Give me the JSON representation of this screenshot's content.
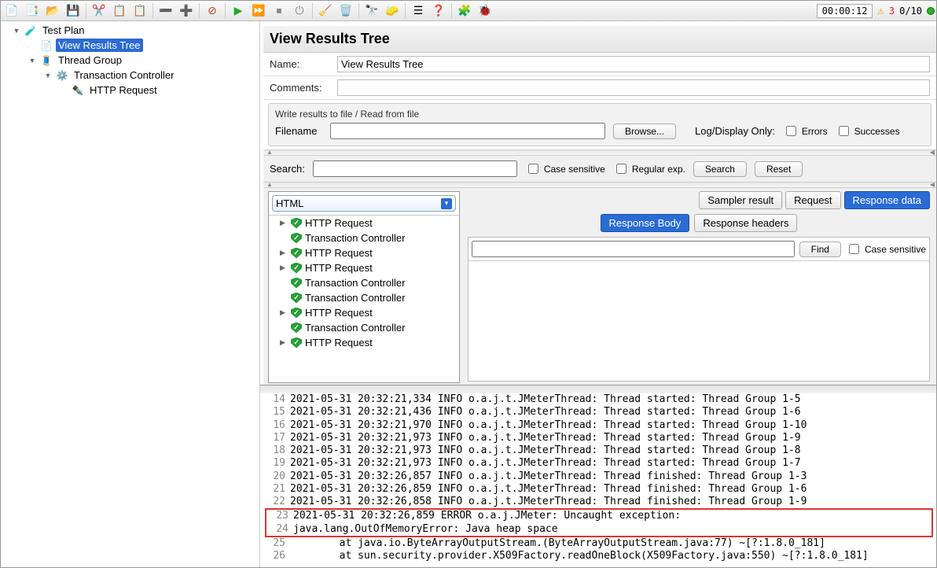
{
  "status_bar": {
    "timer": "00:00:12",
    "warn_count": "3",
    "threads": "0/10"
  },
  "toolbar_icons": [
    "new",
    "templates",
    "open",
    "save",
    "",
    "cut",
    "copy",
    "paste",
    "",
    "expand",
    "collapse",
    "",
    "toggle",
    "",
    "start",
    "start-no-pause",
    "stop",
    "shutdown",
    "",
    "clear",
    "clear-all",
    "",
    "search-tb",
    "func",
    "",
    "props",
    "help",
    "",
    "heap",
    "debug"
  ],
  "tree": [
    {
      "depth": 1,
      "twisty": "▼",
      "icon": "🧪",
      "label": "Test Plan",
      "selected": false,
      "name": "tree-test-plan"
    },
    {
      "depth": 2,
      "twisty": "",
      "icon": "📄",
      "label": "View Results Tree",
      "selected": true,
      "name": "tree-view-results-tree"
    },
    {
      "depth": 2,
      "twisty": "▼",
      "icon": "🧵",
      "label": "Thread Group",
      "selected": false,
      "name": "tree-thread-group"
    },
    {
      "depth": 3,
      "twisty": "▼",
      "icon": "⚙️",
      "label": "Transaction Controller",
      "selected": false,
      "name": "tree-transaction-controller"
    },
    {
      "depth": 4,
      "twisty": "",
      "icon": "✒️",
      "label": "HTTP Request",
      "selected": false,
      "name": "tree-http-request"
    }
  ],
  "panel": {
    "title": "View Results Tree",
    "name_label": "Name:",
    "name_value": "View Results Tree",
    "comments_label": "Comments:",
    "comments_value": "",
    "file_section": {
      "legend": "Write results to file / Read from file",
      "filename_label": "Filename",
      "filename_value": "",
      "browse_label": "Browse...",
      "logdisplay_label": "Log/Display Only:",
      "errors_label": "Errors",
      "successes_label": "Successes"
    },
    "search": {
      "label": "Search:",
      "value": "",
      "case_label": "Case sensitive",
      "regex_label": "Regular exp.",
      "search_btn": "Search",
      "reset_btn": "Reset"
    },
    "renderer": "HTML",
    "tabs": {
      "sampler": "Sampler result",
      "request": "Request",
      "response": "Response data",
      "resp_body": "Response Body",
      "resp_headers": "Response headers"
    },
    "find": {
      "value": "",
      "btn": "Find",
      "case_label": "Case sensitive"
    },
    "results": [
      {
        "twisty": "▶",
        "label": "HTTP Request"
      },
      {
        "twisty": "",
        "label": "Transaction Controller"
      },
      {
        "twisty": "▶",
        "label": "HTTP Request"
      },
      {
        "twisty": "▶",
        "label": "HTTP Request"
      },
      {
        "twisty": "",
        "label": "Transaction Controller"
      },
      {
        "twisty": "",
        "label": "Transaction Controller"
      },
      {
        "twisty": "▶",
        "label": "HTTP Request"
      },
      {
        "twisty": "",
        "label": "Transaction Controller"
      },
      {
        "twisty": "▶",
        "label": "HTTP Request"
      }
    ]
  },
  "log": [
    {
      "n": 14,
      "t": "2021-05-31 20:32:21,334 INFO o.a.j.t.JMeterThread: Thread started: Thread Group 1-5"
    },
    {
      "n": 15,
      "t": "2021-05-31 20:32:21,436 INFO o.a.j.t.JMeterThread: Thread started: Thread Group 1-6"
    },
    {
      "n": 16,
      "t": "2021-05-31 20:32:21,970 INFO o.a.j.t.JMeterThread: Thread started: Thread Group 1-10"
    },
    {
      "n": 17,
      "t": "2021-05-31 20:32:21,973 INFO o.a.j.t.JMeterThread: Thread started: Thread Group 1-9"
    },
    {
      "n": 18,
      "t": "2021-05-31 20:32:21,973 INFO o.a.j.t.JMeterThread: Thread started: Thread Group 1-8"
    },
    {
      "n": 19,
      "t": "2021-05-31 20:32:21,973 INFO o.a.j.t.JMeterThread: Thread started: Thread Group 1-7"
    },
    {
      "n": 20,
      "t": "2021-05-31 20:32:26,857 INFO o.a.j.t.JMeterThread: Thread finished: Thread Group 1-3"
    },
    {
      "n": 21,
      "t": "2021-05-31 20:32:26,859 INFO o.a.j.t.JMeterThread: Thread finished: Thread Group 1-6"
    },
    {
      "n": 22,
      "t": "2021-05-31 20:32:26,858 INFO o.a.j.t.JMeterThread: Thread finished: Thread Group 1-9"
    },
    {
      "n": 23,
      "t": "2021-05-31 20:32:26,859 ERROR o.a.j.JMeter: Uncaught exception:",
      "err": true
    },
    {
      "n": 24,
      "t": "java.lang.OutOfMemoryError: Java heap space",
      "err": true
    },
    {
      "n": 25,
      "t": "        at java.io.ByteArrayOutputStream.<init>(ByteArrayOutputStream.java:77) ~[?:1.8.0_181]"
    },
    {
      "n": 26,
      "t": "        at sun.security.provider.X509Factory.readOneBlock(X509Factory.java:550) ~[?:1.8.0_181]"
    }
  ]
}
